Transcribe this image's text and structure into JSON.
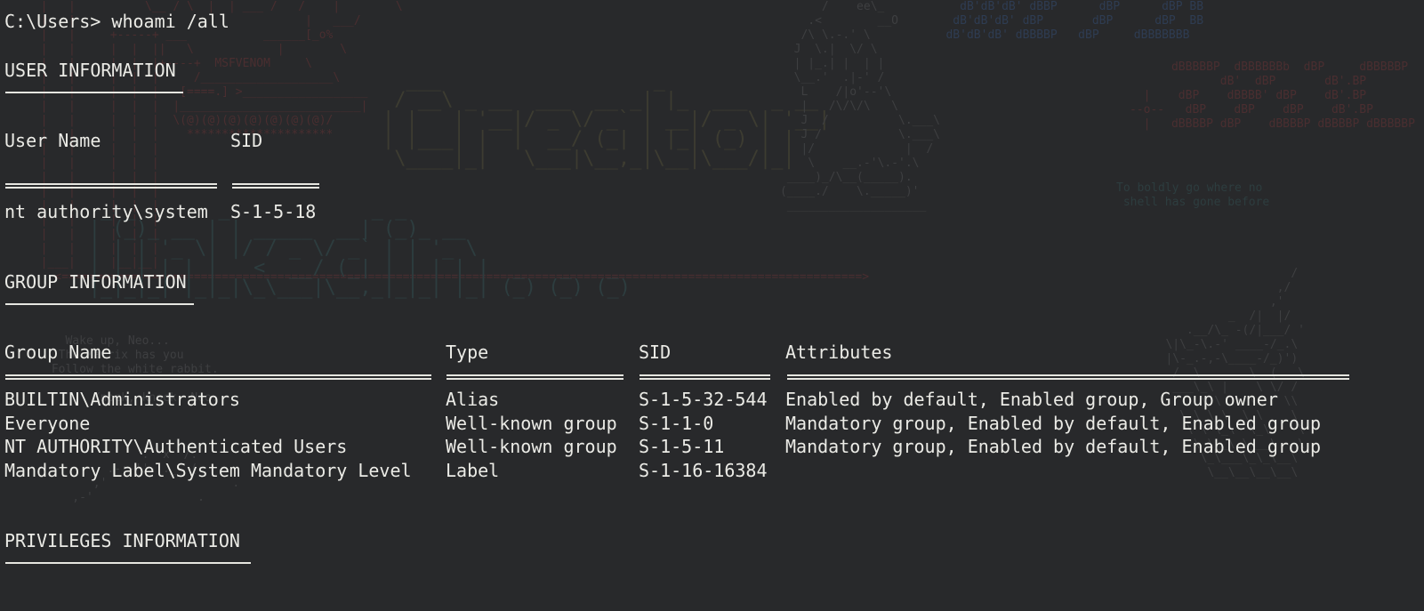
{
  "prompt": {
    "path": "C:\\Users>",
    "command": "whoami /all"
  },
  "user_info": {
    "heading": "USER INFORMATION",
    "columns": [
      "User Name",
      "SID"
    ],
    "rows": [
      [
        "nt authority\\system",
        "S-1-5-18"
      ]
    ]
  },
  "group_info": {
    "heading": "GROUP INFORMATION",
    "columns": [
      "Group Name",
      "Type",
      "SID",
      "Attributes"
    ],
    "rows": [
      [
        "BUILTIN\\Administrators",
        "Alias",
        "S-1-5-32-544",
        "Enabled by default, Enabled group, Group owner"
      ],
      [
        "Everyone",
        "Well-known group",
        "S-1-1-0",
        "Mandatory group, Enabled by default, Enabled group"
      ],
      [
        "NT AUTHORITY\\Authenticated Users",
        "Well-known group",
        "S-1-5-11",
        "Mandatory group, Enabled by default, Enabled group"
      ],
      [
        "Mandatory Label\\System Mandatory Level",
        "Label",
        "S-1-16-16384",
        ""
      ]
    ]
  },
  "privileges_info": {
    "heading": "PRIVILEGES INFORMATION"
  },
  "background": {
    "wallpaper_tags": [
      "MSFVENOM",
      "To boldly go where no",
      "shell has gone before",
      "Wake up, Neo...",
      "The Matrix has you",
      "Follow the white rabbit.",
      "Knock, knock, Neo."
    ]
  },
  "colors": {
    "background": "#28292b",
    "foreground": "#ebebe6"
  }
}
